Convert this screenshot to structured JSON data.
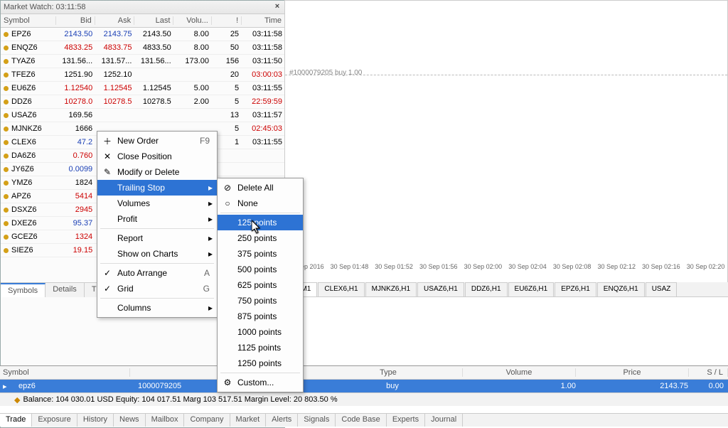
{
  "market_watch": {
    "title": "Market Watch: 03:11:58",
    "headers": {
      "symbol": "Symbol",
      "bid": "Bid",
      "ask": "Ask",
      "last": "Last",
      "vol": "Volu...",
      "int": "!",
      "time": "Time"
    },
    "rows": [
      {
        "sym": "EPZ6",
        "bid": "2143.50",
        "ask": "2143.75",
        "last": "2143.50",
        "vol": "8.00",
        "int": "25",
        "time": "03:11:58",
        "cls": "blue"
      },
      {
        "sym": "ENQZ6",
        "bid": "4833.25",
        "ask": "4833.75",
        "last": "4833.50",
        "vol": "8.00",
        "int": "50",
        "time": "03:11:58",
        "cls": "red"
      },
      {
        "sym": "TYAZ6",
        "bid": "131.56...",
        "ask": "131.57...",
        "last": "131.56...",
        "vol": "173.00",
        "int": "156",
        "time": "03:11:50",
        "cls": ""
      },
      {
        "sym": "TFEZ6",
        "bid": "1251.90",
        "ask": "1252.10",
        "last": "",
        "vol": "",
        "int": "20",
        "time": "03:00:03",
        "cls": "",
        "tcls": "red"
      },
      {
        "sym": "EU6Z6",
        "bid": "1.12540",
        "ask": "1.12545",
        "last": "1.12545",
        "vol": "5.00",
        "int": "5",
        "time": "03:11:55",
        "cls": "red"
      },
      {
        "sym": "DDZ6",
        "bid": "10278.0",
        "ask": "10278.5",
        "last": "10278.5",
        "vol": "2.00",
        "int": "5",
        "time": "22:59:59",
        "cls": "red",
        "tcls": "red"
      },
      {
        "sym": "USAZ6",
        "bid": "169.56",
        "ask": "",
        "last": "",
        "vol": "",
        "int": "13",
        "time": "03:11:57",
        "cls": ""
      },
      {
        "sym": "MJNKZ6",
        "bid": "1666",
        "ask": "",
        "last": "",
        "vol": "",
        "int": "5",
        "time": "02:45:03",
        "cls": "",
        "tcls": "red"
      },
      {
        "sym": "CLEX6",
        "bid": "47.2",
        "ask": "",
        "last": "",
        "vol": "",
        "int": "1",
        "time": "03:11:55",
        "cls": "blue"
      },
      {
        "sym": "DA6Z6",
        "bid": "0.760",
        "ask": "",
        "last": "",
        "vol": "",
        "int": "",
        "time": "",
        "cls": "red"
      },
      {
        "sym": "JY6Z6",
        "bid": "0.0099",
        "ask": "",
        "last": "",
        "vol": "",
        "int": "",
        "time": "",
        "cls": "blue"
      },
      {
        "sym": "YMZ6",
        "bid": "1824",
        "ask": "",
        "last": "",
        "vol": "",
        "int": "",
        "time": "",
        "cls": ""
      },
      {
        "sym": "APZ6",
        "bid": "5414",
        "ask": "",
        "last": "",
        "vol": "",
        "int": "",
        "time": "",
        "cls": "red"
      },
      {
        "sym": "DSXZ6",
        "bid": "2945",
        "ask": "",
        "last": "",
        "vol": "",
        "int": "",
        "time": "",
        "cls": "red"
      },
      {
        "sym": "DXEZ6",
        "bid": "95.37",
        "ask": "",
        "last": "",
        "vol": "",
        "int": "",
        "time": "",
        "cls": "blue"
      },
      {
        "sym": "GCEZ6",
        "bid": "1324",
        "ask": "",
        "last": "",
        "vol": "",
        "int": "",
        "time": "",
        "cls": "red"
      },
      {
        "sym": "SIEZ6",
        "bid": "19.15",
        "ask": "",
        "last": "",
        "vol": "",
        "int": "",
        "time": "",
        "cls": "red"
      }
    ],
    "tabs": [
      "Symbols",
      "Details",
      "T"
    ]
  },
  "context_menu": {
    "items": [
      {
        "label": "New Order",
        "kb": "F9",
        "ico": "＋"
      },
      {
        "label": "Close Position",
        "ico": "✕"
      },
      {
        "label": "Modify or Delete",
        "ico": "✎"
      },
      {
        "label": "Trailing Stop",
        "sub": true,
        "hl": true
      },
      {
        "label": "Volumes",
        "sub": true
      },
      {
        "label": "Profit",
        "sub": true
      },
      {
        "sep": true
      },
      {
        "label": "Report",
        "sub": true
      },
      {
        "label": "Show on Charts",
        "sub": true
      },
      {
        "sep": true
      },
      {
        "label": "Auto Arrange",
        "kb": "A",
        "chk": true
      },
      {
        "label": "Grid",
        "kb": "G",
        "chk": true
      },
      {
        "sep": true
      },
      {
        "label": "Columns",
        "sub": true
      }
    ]
  },
  "submenu": {
    "items": [
      {
        "label": "Delete All",
        "ico": "⊘"
      },
      {
        "label": "None",
        "ico": "○"
      },
      {
        "sep": true
      },
      {
        "label": "125 points",
        "hl": true
      },
      {
        "label": "250 points"
      },
      {
        "label": "375 points"
      },
      {
        "label": "500 points"
      },
      {
        "label": "625 points"
      },
      {
        "label": "750 points"
      },
      {
        "label": "875 points"
      },
      {
        "label": "1000 points"
      },
      {
        "label": "1125 points"
      },
      {
        "label": "1250 points"
      },
      {
        "sep": true
      },
      {
        "label": "Custom...",
        "ico": "⚙"
      }
    ]
  },
  "chart": {
    "order_label": "#1000079205 buy 1.00",
    "time_ticks": [
      "30 Sep 2016",
      "30 Sep 01:48",
      "30 Sep 01:52",
      "30 Sep 01:56",
      "30 Sep 02:00",
      "30 Sep 02:04",
      "30 Sep 02:08",
      "30 Sep 02:12",
      "30 Sep 02:16",
      "30 Sep 02:20"
    ],
    "tabs": [
      "Z6,M1",
      "CLEX6,H1",
      "MJNKZ6,H1",
      "USAZ6,H1",
      "DDZ6,H1",
      "EU6Z6,H1",
      "EPZ6,H1",
      "ENQZ6,H1",
      "USAZ"
    ]
  },
  "terminal": {
    "headers": {
      "symbol": "Symbol",
      "order": "",
      "type": "Type",
      "volume": "Volume",
      "price": "Price",
      "sl": "S / L"
    },
    "row": {
      "symbol": "epz6",
      "order": "1000079205",
      "type": "buy",
      "volume": "1.00",
      "price": "2143.75",
      "sl": "0.00"
    },
    "status": "Balance: 104 030.01 USD  Equity: 104 017.51  Marg                        103 517.51  Margin Level: 20 803.50 %"
  },
  "bottom_tabs": [
    "Trade",
    "Exposure",
    "History",
    "News",
    "Mailbox",
    "Company",
    "Market",
    "Alerts",
    "Signals",
    "Code Base",
    "Experts",
    "Journal"
  ]
}
